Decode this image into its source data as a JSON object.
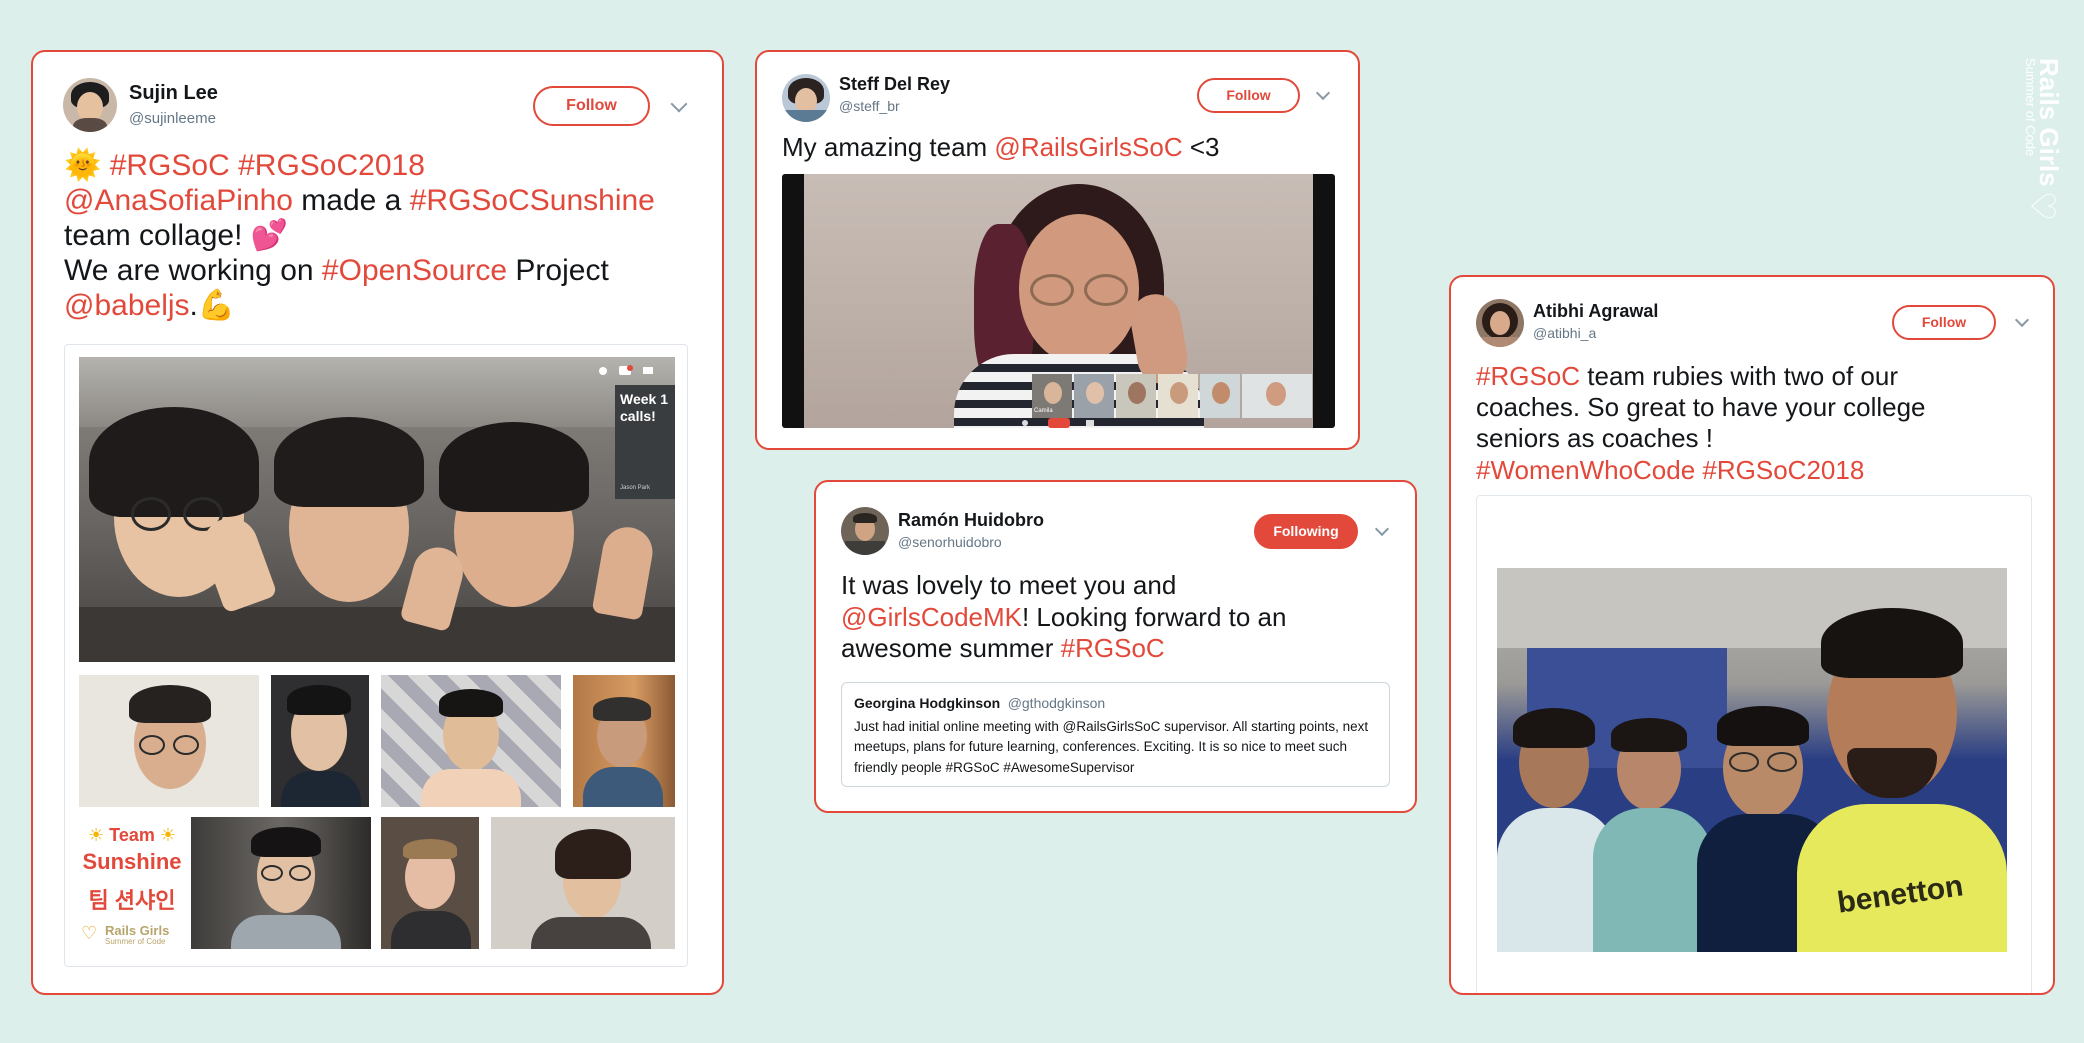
{
  "colors": {
    "accent": "#e2493b",
    "background": "#dcefea"
  },
  "brand": {
    "line1": "Rails Girls",
    "line2": "Summer of Code"
  },
  "tweets": {
    "sujin": {
      "name": "Sujin Lee",
      "handle": "@sujinleeme",
      "follow_label": "Follow",
      "text": {
        "emoji1": "🌞",
        "tag1": "#RGSoC",
        "tag2": "#RGSoC2018",
        "mention1": "@AnaSofiaPinho",
        "t1": "made a",
        "tag3": "#RGSoCSunshine",
        "t2": "team collage!",
        "emoji2": "💕",
        "t3": "We are working on",
        "tag4": "#OpenSource",
        "t4": "Project",
        "mention2": "@babeljs",
        "t5": ".",
        "emoji3": "💪"
      },
      "overlay": {
        "week_text": "Week 1 calls!",
        "caller_name": "Jason Park"
      },
      "collage": {
        "team_word": "Team",
        "team_name": "Sunshine",
        "team_korean": "팀 션샤인",
        "logo_line1": "Rails Girls",
        "logo_line2": "Summer of Code"
      }
    },
    "steff": {
      "name": "Steff Del Rey",
      "handle": "@steff_br",
      "follow_label": "Follow",
      "text": {
        "t1": "My amazing team",
        "mention": "@RailsGirlsSoC",
        "t2": "<3"
      },
      "thumb_label": "Camila"
    },
    "ramon": {
      "name": "Ramón Huidobro",
      "handle": "@senorhuidobro",
      "follow_label": "Following",
      "text": {
        "t1": "It was lovely to meet you and",
        "mention": "@GirlsCodeMK",
        "t2": "! Looking forward to an awesome summer",
        "tag": "#RGSoC"
      },
      "quote": {
        "name": "Georgina Hodgkinson",
        "handle": "@gthodgkinson",
        "text": "Just had initial online meeting with @RailsGirlsSoC supervisor.  All starting points, next meetups, plans for future learning, conferences.  Exciting.  It is so nice to meet such friendly people  #RGSoC #AwesomeSupervisor"
      }
    },
    "atibhi": {
      "name": "Atibhi Agrawal",
      "handle": "@atibhi_a",
      "follow_label": "Follow",
      "text": {
        "tag1": "#RGSoC",
        "t1": "team rubies with two of our coaches. So great to have your college seniors as coaches !",
        "tag2": "#WomenWhoCode",
        "tag3": "#RGSoC2018"
      },
      "shirt_text": "benetton"
    }
  }
}
